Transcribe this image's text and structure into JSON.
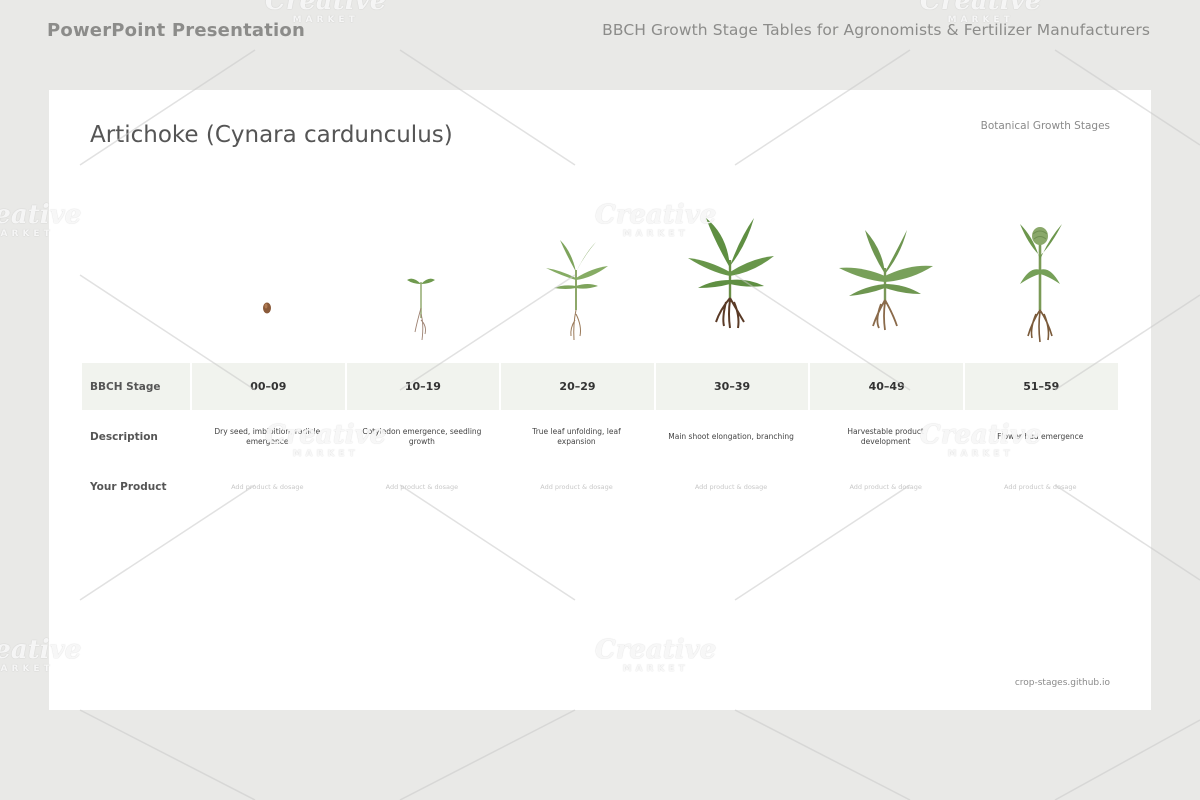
{
  "header": {
    "left": "PowerPoint Presentation",
    "right": "BBCH Growth Stage Tables for Agronomists & Fertilizer Manufacturers"
  },
  "slide": {
    "title": "Artichoke (Cynara cardunculus)",
    "subtitle": "Botanical Growth Stages",
    "footer": "crop-stages.github.io"
  },
  "table": {
    "row_labels": {
      "stage": "BBCH Stage",
      "description": "Description",
      "product": "Your Product"
    },
    "stages": [
      {
        "code": "00–09",
        "description": "Dry seed, imbibition, radicle emergence",
        "product": "Add product & dosage",
        "plant_icon": "seed-icon"
      },
      {
        "code": "10–19",
        "description": "Cotyledon emergence, seedling growth",
        "product": "Add product & dosage",
        "plant_icon": "seedling-icon"
      },
      {
        "code": "20–29",
        "description": "True leaf unfolding, leaf expansion",
        "product": "Add product & dosage",
        "plant_icon": "young-plant-icon"
      },
      {
        "code": "30–39",
        "description": "Main shoot elongation, branching",
        "product": "Add product & dosage",
        "plant_icon": "leafy-plant-icon"
      },
      {
        "code": "40–49",
        "description": "Harvestable product development",
        "product": "Add product & dosage",
        "plant_icon": "bushy-plant-icon"
      },
      {
        "code": "51–59",
        "description": "Flower bud emergence",
        "product": "Add product & dosage",
        "plant_icon": "budding-artichoke-icon"
      }
    ]
  },
  "watermark": {
    "brand": "Creative",
    "sub": "MARKET"
  },
  "colors": {
    "background": "#e9e9e7",
    "slide": "#ffffff",
    "stage_row": "#f1f3ee",
    "leaf_green": "#6f9a4e",
    "root_brown": "#8a6a4a"
  }
}
